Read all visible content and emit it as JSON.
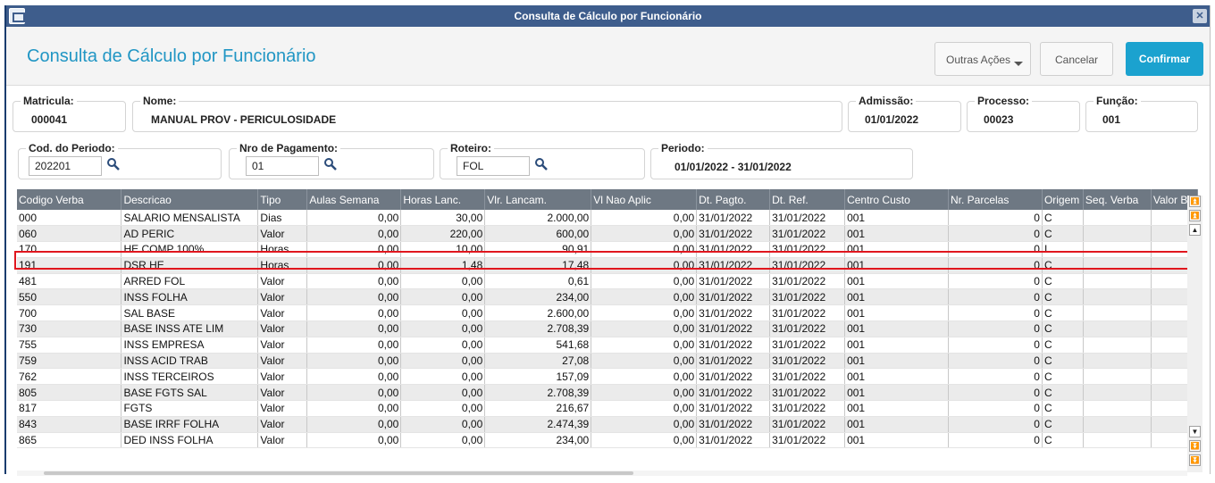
{
  "window": {
    "title": "Consulta de Cálculo por Funcionário"
  },
  "header": {
    "title": "Consulta de Cálculo por Funcionário",
    "outras_acoes": "Outras Ações",
    "cancelar": "Cancelar",
    "confirmar": "Confirmar"
  },
  "fields": {
    "matricula": {
      "label": "Matricula:",
      "value": "000041"
    },
    "nome": {
      "label": "Nome:",
      "value": "MANUAL PROV - PERICULOSIDADE"
    },
    "admissao": {
      "label": "Admissão:",
      "value": "01/01/2022"
    },
    "processo": {
      "label": "Processo:",
      "value": "00023"
    },
    "funcao": {
      "label": "Função:",
      "value": "001"
    },
    "cod_periodo": {
      "label": "Cod. do Periodo:",
      "value": "202201"
    },
    "nro_pagamento": {
      "label": "Nro de Pagamento:",
      "value": "01"
    },
    "roteiro": {
      "label": "Roteiro:",
      "value": "FOL"
    },
    "periodo": {
      "label": "Periodo:",
      "value": "01/01/2022 - 31/01/2022"
    }
  },
  "table": {
    "columns": [
      "Codigo Verba",
      "Descricao",
      "Tipo",
      "Aulas Semana",
      "Horas Lanc.",
      "Vlr. Lancam.",
      "Vl Nao Aplic",
      "Dt. Pagto.",
      "Dt. Ref.",
      "Centro Custo",
      "Nr. Parcelas",
      "Origem",
      "Seq. Verba",
      "Valor B"
    ],
    "rows": [
      [
        "000",
        "SALARIO MENSALISTA",
        "Dias",
        "0,00",
        "30,00",
        "2.000,00",
        "0,00",
        "31/01/2022",
        "31/01/2022",
        "001",
        "0",
        "C",
        "",
        ""
      ],
      [
        "060",
        "AD PERIC",
        "Valor",
        "0,00",
        "220,00",
        "600,00",
        "0,00",
        "31/01/2022",
        "31/01/2022",
        "001",
        "0",
        "C",
        "",
        ""
      ],
      [
        "170",
        "HE COMP 100%",
        "Horas",
        "0,00",
        "10,00",
        "90,91",
        "0,00",
        "31/01/2022",
        "31/01/2022",
        "001",
        "0",
        "I",
        "",
        ""
      ],
      [
        "191",
        "DSR HE",
        "Horas",
        "0,00",
        "1,48",
        "17,48",
        "0,00",
        "31/01/2022",
        "31/01/2022",
        "001",
        "0",
        "C",
        "",
        ""
      ],
      [
        "481",
        "ARRED FOL",
        "Valor",
        "0,00",
        "0,00",
        "0,61",
        "0,00",
        "31/01/2022",
        "31/01/2022",
        "001",
        "0",
        "C",
        "",
        ""
      ],
      [
        "550",
        "INSS FOLHA",
        "Valor",
        "0,00",
        "0,00",
        "234,00",
        "0,00",
        "31/01/2022",
        "31/01/2022",
        "001",
        "0",
        "C",
        "",
        ""
      ],
      [
        "700",
        "SAL BASE",
        "Valor",
        "0,00",
        "0,00",
        "2.600,00",
        "0,00",
        "31/01/2022",
        "31/01/2022",
        "001",
        "0",
        "C",
        "",
        ""
      ],
      [
        "730",
        "BASE INSS ATE LIM",
        "Valor",
        "0,00",
        "0,00",
        "2.708,39",
        "0,00",
        "31/01/2022",
        "31/01/2022",
        "001",
        "0",
        "C",
        "",
        ""
      ],
      [
        "755",
        "INSS EMPRESA",
        "Valor",
        "0,00",
        "0,00",
        "541,68",
        "0,00",
        "31/01/2022",
        "31/01/2022",
        "001",
        "0",
        "C",
        "",
        ""
      ],
      [
        "759",
        "INSS ACID TRAB",
        "Valor",
        "0,00",
        "0,00",
        "27,08",
        "0,00",
        "31/01/2022",
        "31/01/2022",
        "001",
        "0",
        "C",
        "",
        ""
      ],
      [
        "762",
        "INSS TERCEIROS",
        "Valor",
        "0,00",
        "0,00",
        "157,09",
        "0,00",
        "31/01/2022",
        "31/01/2022",
        "001",
        "0",
        "C",
        "",
        ""
      ],
      [
        "805",
        "BASE FGTS SAL",
        "Valor",
        "0,00",
        "0,00",
        "2.708,39",
        "0,00",
        "31/01/2022",
        "31/01/2022",
        "001",
        "0",
        "C",
        "",
        ""
      ],
      [
        "817",
        "FGTS",
        "Valor",
        "0,00",
        "0,00",
        "216,67",
        "0,00",
        "31/01/2022",
        "31/01/2022",
        "001",
        "0",
        "C",
        "",
        ""
      ],
      [
        "843",
        "BASE IRRF FOLHA",
        "Valor",
        "0,00",
        "0,00",
        "2.474,39",
        "0,00",
        "31/01/2022",
        "31/01/2022",
        "001",
        "0",
        "C",
        "",
        ""
      ],
      [
        "865",
        "DED INSS FOLHA",
        "Valor",
        "0,00",
        "0,00",
        "234,00",
        "0,00",
        "31/01/2022",
        "31/01/2022",
        "001",
        "0",
        "C",
        "",
        ""
      ]
    ],
    "highlighted_row": "170"
  }
}
